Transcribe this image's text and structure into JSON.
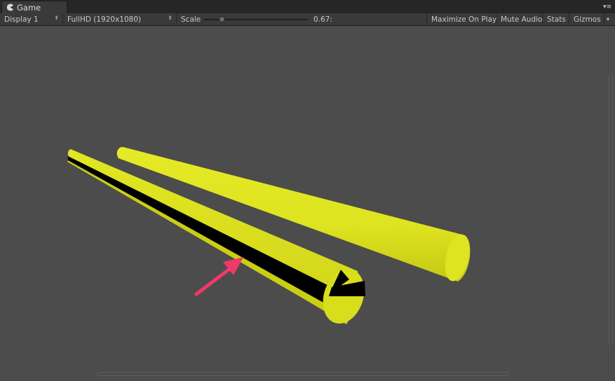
{
  "window": {
    "tab_label": "Game",
    "tab_icon": "pacman-icon",
    "menu_icon": "window-menu-icon"
  },
  "toolbar": {
    "display": "Display 1",
    "resolution": "FullHD (1920x1080)",
    "scale_label": "Scale",
    "scale_value": "0.67:",
    "scale_level": 0.17,
    "maximize": "Maximize On Play",
    "mute": "Mute Audio",
    "stats": "Stats",
    "gizmos": "Gizmos"
  },
  "scene": {
    "objects": [
      "yellow-cylinder",
      "yellow-pipe-with-black-interior"
    ],
    "annotation": "pink-arrow",
    "colors": {
      "viewport_bg": "#4c4c4c",
      "cylinder": "#dde31f",
      "cylinder_dark": "#b9bf14",
      "interior": "#000000",
      "arrow": "#f0386b"
    }
  }
}
